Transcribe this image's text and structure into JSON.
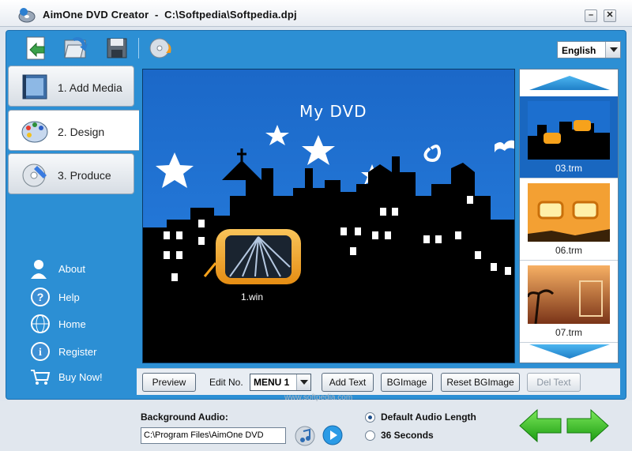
{
  "window": {
    "title": "AimOne DVD Creator",
    "project_path": "C:\\Softpedia\\Softpedia.dpj",
    "minimize_glyph": "–",
    "close_glyph": "✕"
  },
  "toolbar": {
    "icons": [
      "new-project-icon",
      "open-project-icon",
      "save-project-icon",
      "burn-disc-icon"
    ],
    "language": "English"
  },
  "sidebar": {
    "tabs": [
      {
        "label": "1. Add Media",
        "icon": "film-icon"
      },
      {
        "label": "2. Design",
        "icon": "palette-icon"
      },
      {
        "label": "3. Produce",
        "icon": "disc-icon"
      }
    ],
    "links": [
      {
        "label": "About",
        "icon": "user-icon"
      },
      {
        "label": "Help",
        "icon": "help-icon"
      },
      {
        "label": "Home",
        "icon": "globe-icon"
      },
      {
        "label": "Register",
        "icon": "info-icon"
      },
      {
        "label": "Buy Now!",
        "icon": "cart-icon"
      }
    ]
  },
  "preview": {
    "menu_title": "My DVD",
    "media_button_label": "1.win"
  },
  "thumbnails": [
    {
      "label": "03.trm",
      "selected": true
    },
    {
      "label": "06.trm",
      "selected": false
    },
    {
      "label": "07.trm",
      "selected": false
    }
  ],
  "edit_bar": {
    "preview_label": "Preview",
    "edit_no_label": "Edit No.",
    "menu_value": "MENU 1",
    "add_text_label": "Add Text",
    "bgimage_label": "BGImage",
    "reset_bgimage_label": "Reset BGImage",
    "del_text_label": "Del Text"
  },
  "audio": {
    "label": "Background Audio:",
    "path": "C:\\Program Files\\AimOne DVD",
    "options": [
      {
        "label": "Default Audio Length",
        "checked": true
      },
      {
        "label": "36 Seconds",
        "checked": false
      }
    ]
  },
  "navigation": {
    "back": "back-arrow-icon",
    "next": "next-arrow-icon"
  },
  "watermark": "www.softpedia.com",
  "colors": {
    "frame": "#2c8fd4",
    "preview_sky": "#1e6ccd",
    "accent_orange": "#f7a21b",
    "nav_green": "#33c21e"
  }
}
